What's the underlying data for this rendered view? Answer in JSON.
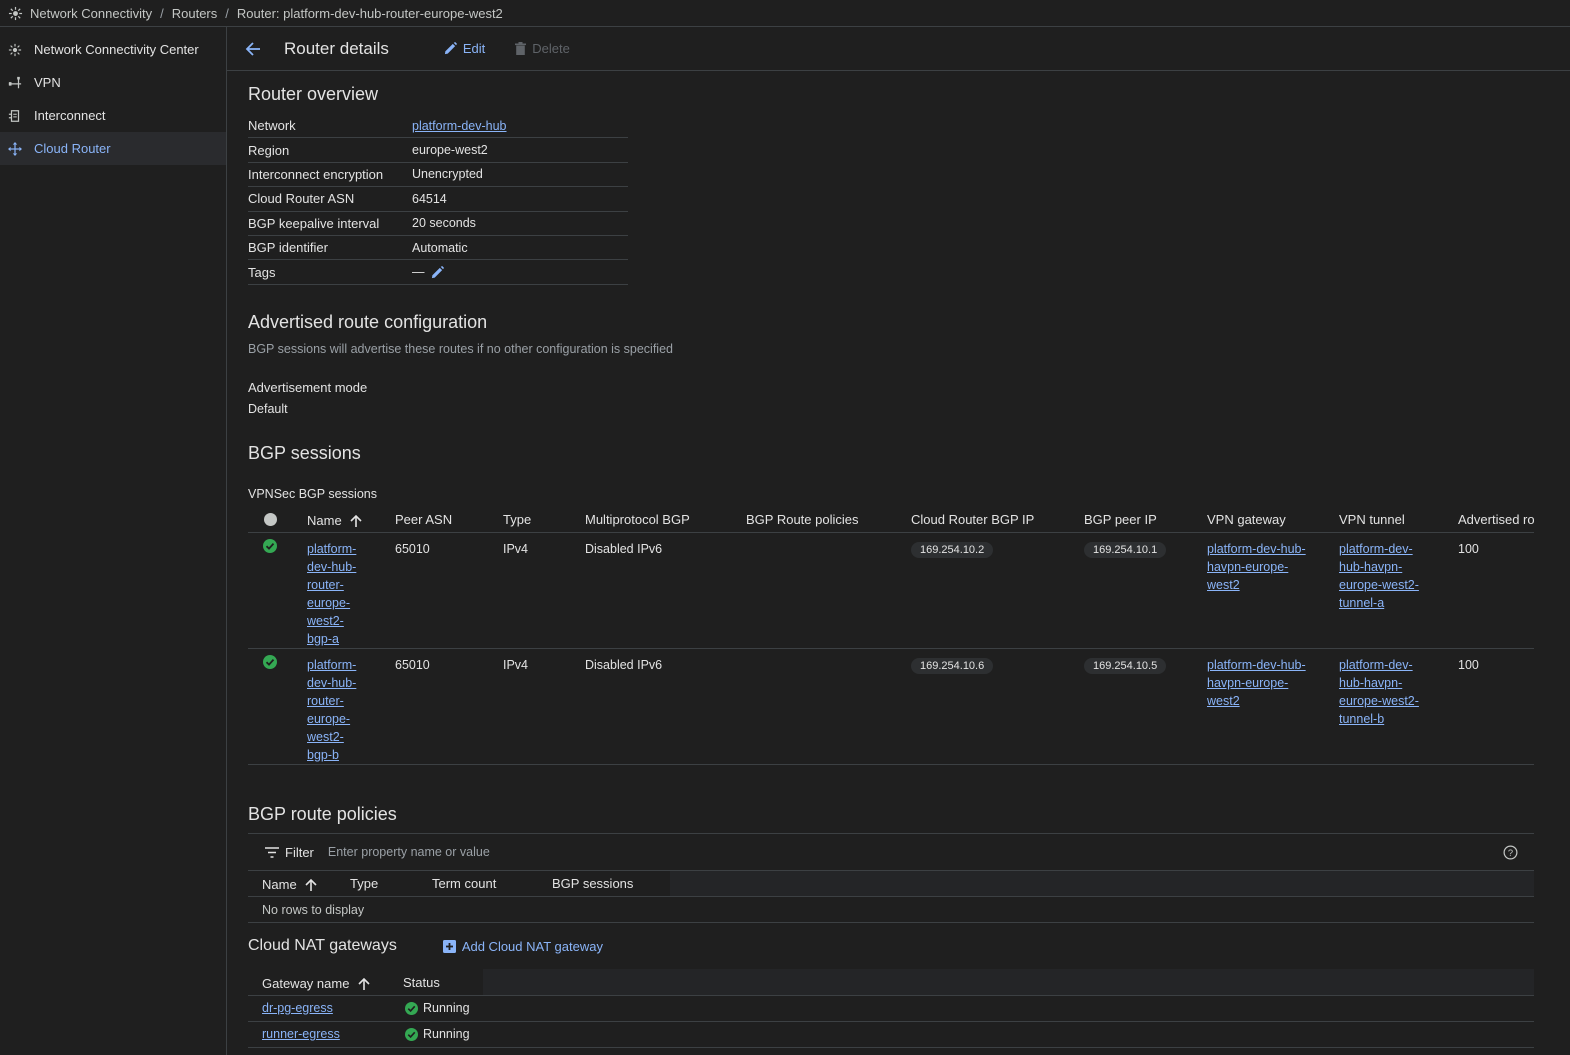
{
  "breadcrumb": {
    "root": "Network Connectivity",
    "routers": "Routers",
    "current": "Router: platform-dev-hub-router-europe-west2"
  },
  "sidebar": {
    "items": [
      {
        "label": "Network Connectivity Center",
        "icon": "hub-icon"
      },
      {
        "label": "VPN",
        "icon": "vpn-icon"
      },
      {
        "label": "Interconnect",
        "icon": "interconnect-icon"
      },
      {
        "label": "Cloud Router",
        "icon": "cloud-router-icon",
        "active": true
      }
    ]
  },
  "header": {
    "title": "Router details",
    "edit_label": "Edit",
    "delete_label": "Delete"
  },
  "overview": {
    "title": "Router overview",
    "rows": [
      {
        "key": "Network",
        "value": "platform-dev-hub"
      },
      {
        "key": "Region",
        "value": "europe-west2"
      },
      {
        "key": "Interconnect encryption",
        "value": "Unencrypted"
      },
      {
        "key": "Cloud Router ASN",
        "value": "64514"
      },
      {
        "key": "BGP keepalive interval",
        "value": "20 seconds"
      },
      {
        "key": "BGP identifier",
        "value": "Automatic"
      },
      {
        "key": "Tags",
        "value": "—"
      }
    ]
  },
  "advertised": {
    "title": "Advertised route configuration",
    "description": "BGP sessions will advertise these routes if no other configuration is specified",
    "mode_label": "Advertisement mode",
    "mode_value": "Default"
  },
  "bgp": {
    "title": "BGP sessions",
    "subtitle": "VPNSec BGP sessions",
    "columns": [
      "Name",
      "Peer ASN",
      "Type",
      "Multiprotocol BGP",
      "BGP Route policies",
      "Cloud Router BGP IP",
      "BGP peer IP",
      "VPN gateway",
      "VPN tunnel",
      "Advertised ro"
    ],
    "rows": [
      {
        "name_lines": [
          "platform-",
          "dev-hub-",
          "router-",
          "europe-",
          "west2-",
          "bgp-a"
        ],
        "peer_asn": "65010",
        "type": "IPv4",
        "multiprotocol": "Disabled IPv6",
        "policies": "",
        "router_ip": "169.254.10.2",
        "peer_ip": "169.254.10.1",
        "gateway_lines": [
          "platform-dev-hub-",
          "havpn-europe-",
          "west2"
        ],
        "tunnel_lines": [
          "platform-dev-",
          "hub-havpn-",
          "europe-west2-",
          "tunnel-a"
        ],
        "advertised": "100"
      },
      {
        "name_lines": [
          "platform-",
          "dev-hub-",
          "router-",
          "europe-",
          "west2-",
          "bgp-b"
        ],
        "peer_asn": "65010",
        "type": "IPv4",
        "multiprotocol": "Disabled IPv6",
        "policies": "",
        "router_ip": "169.254.10.6",
        "peer_ip": "169.254.10.5",
        "gateway_lines": [
          "platform-dev-hub-",
          "havpn-europe-",
          "west2"
        ],
        "tunnel_lines": [
          "platform-dev-",
          "hub-havpn-",
          "europe-west2-",
          "tunnel-b"
        ],
        "advertised": "100"
      }
    ]
  },
  "policies": {
    "title": "BGP route policies",
    "filter_label": "Filter",
    "filter_placeholder": "Enter property name or value",
    "columns": [
      "Name",
      "Type",
      "Term count",
      "BGP sessions"
    ],
    "empty": "No rows to display"
  },
  "nat": {
    "title": "Cloud NAT gateways",
    "add_label": "Add Cloud NAT gateway",
    "columns": [
      "Gateway name",
      "Status"
    ],
    "rows": [
      {
        "name": "dr-pg-egress",
        "status": "Running"
      },
      {
        "name": "runner-egress",
        "status": "Running"
      }
    ]
  },
  "colors": {
    "accent": "#8ab4f8",
    "success": "#34a853",
    "background": "#1f1f1f"
  }
}
